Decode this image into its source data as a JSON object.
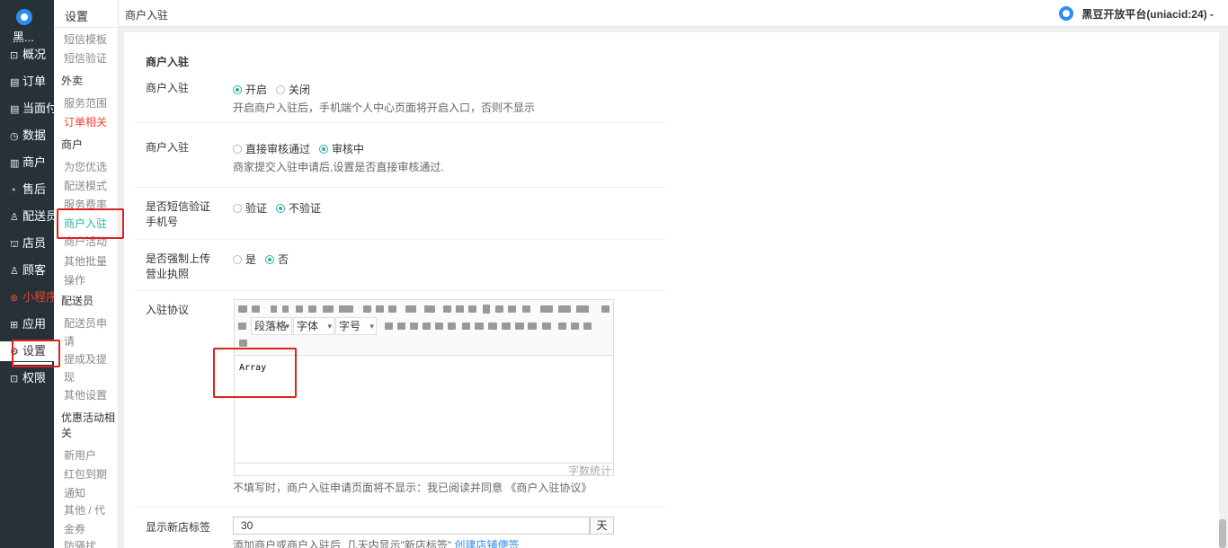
{
  "nav": {
    "brand": "黑...",
    "items": [
      {
        "label": "概况",
        "icon": "dashboard-icon"
      },
      {
        "label": "订单",
        "icon": "order-icon"
      },
      {
        "label": "当面付",
        "icon": "pay-icon"
      },
      {
        "label": "数据",
        "icon": "chart-icon"
      },
      {
        "label": "商户",
        "icon": "store-icon"
      },
      {
        "label": "售后",
        "icon": "aftersale-icon"
      },
      {
        "label": "配送员",
        "icon": "courier-icon"
      },
      {
        "label": "店员",
        "icon": "staff-icon"
      },
      {
        "label": "顾客",
        "icon": "customer-icon"
      },
      {
        "label": "小程序",
        "icon": "miniapp-icon"
      },
      {
        "label": "应用",
        "icon": "apps-icon"
      },
      {
        "label": "设置",
        "icon": "gear-icon"
      },
      {
        "label": "权限",
        "icon": "lock-icon"
      }
    ]
  },
  "submenu": {
    "title": "设置",
    "entries": [
      {
        "kind": "item",
        "label": "短信模板"
      },
      {
        "kind": "item",
        "label": "短信验证"
      },
      {
        "kind": "group",
        "label": "外卖"
      },
      {
        "kind": "item",
        "label": "服务范围"
      },
      {
        "kind": "item",
        "label": "订单相关"
      },
      {
        "kind": "group",
        "label": "商户"
      },
      {
        "kind": "item",
        "label": "为您优选"
      },
      {
        "kind": "item",
        "label": "配送模式"
      },
      {
        "kind": "item",
        "label": "服务费率"
      },
      {
        "kind": "item",
        "label": "商户入驻"
      },
      {
        "kind": "item",
        "label": "商户活动"
      },
      {
        "kind": "item",
        "label": "其他批量"
      },
      {
        "kind": "item",
        "label": "操作"
      },
      {
        "kind": "group",
        "label": "配送员"
      },
      {
        "kind": "item",
        "label": "配送员申"
      },
      {
        "kind": "item",
        "label": "请"
      },
      {
        "kind": "item",
        "label": "提成及提"
      },
      {
        "kind": "item",
        "label": "现"
      },
      {
        "kind": "item",
        "label": "其他设置"
      },
      {
        "kind": "group",
        "label": "优惠活动相关"
      },
      {
        "kind": "item",
        "label": "新用户"
      },
      {
        "kind": "item",
        "label": "红包到期"
      },
      {
        "kind": "item",
        "label": "通知"
      },
      {
        "kind": "item",
        "label": "其他 / 代"
      },
      {
        "kind": "item",
        "label": "金券"
      },
      {
        "kind": "item",
        "label": "防骚扰"
      }
    ]
  },
  "topbar": {
    "breadcrumb": "商户入驻",
    "account": "黑豆开放平台(uniacid:24) -"
  },
  "form": {
    "section_title": "商户入驻",
    "enable": {
      "label": "商户入驻",
      "options": [
        "开启",
        "关闭"
      ],
      "selected": 0,
      "help": "开启商户入驻后，手机端个人中心页面将开启入口，否则不显示"
    },
    "review": {
      "label": "商户入驻",
      "options": [
        "直接审核通过",
        "审核中"
      ],
      "selected": 1,
      "help": "商家提交入驻申请后,设置是否直接审核通过."
    },
    "sms": {
      "label": "是否短信验证手机号",
      "options": [
        "验证",
        "不验证"
      ],
      "selected": 1
    },
    "license": {
      "label": "是否强制上传营业执照",
      "options": [
        "是",
        "否"
      ],
      "selected": 1
    },
    "agreement": {
      "label": "入驻协议",
      "paragraph_select": "段落格",
      "font_select": "字体",
      "size_select": "字号",
      "content": "Array",
      "word_count": "字数统计",
      "help": "不填写时，商户入驻申请页面将不显示：我已阅读并同意 《商户入驻协议》"
    },
    "new_store_tag": {
      "label": "显示新店标签",
      "value": "30",
      "unit": "天",
      "help": "添加商户或商户入驻后, 几天内显示\"新店标签\"",
      "help_link": "创建店铺便签"
    }
  },
  "colors": {
    "nav_bg": "#263238",
    "accent": "#2bb2a2",
    "alert_red": "#e02020",
    "link": "#2d8cf0"
  }
}
